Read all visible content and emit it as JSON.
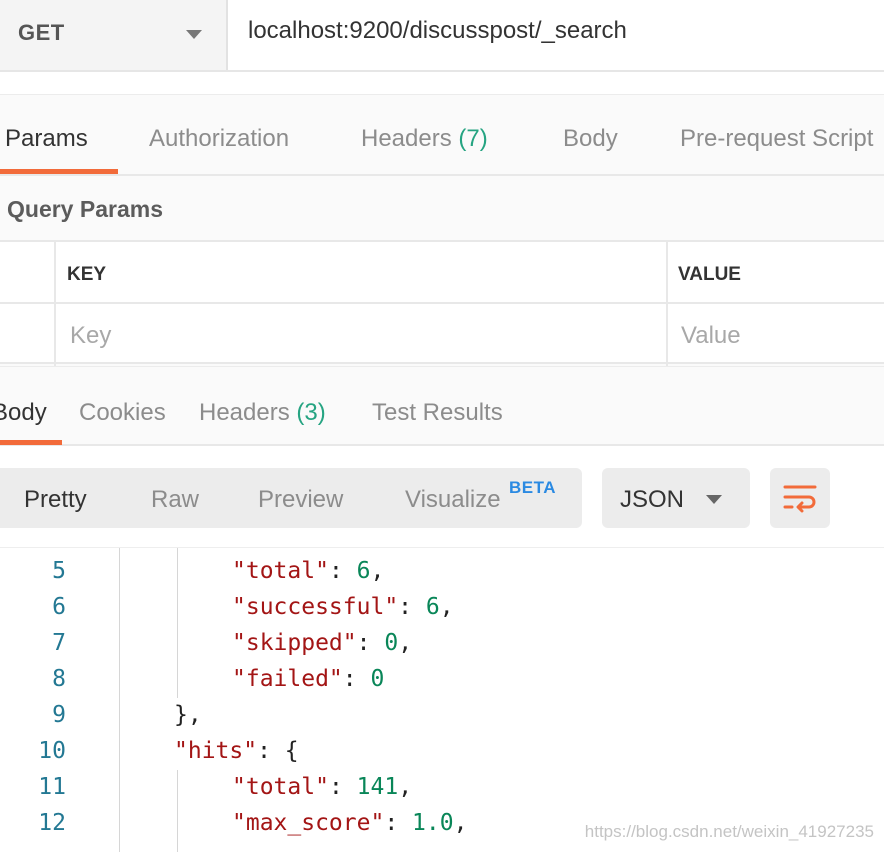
{
  "request": {
    "method": "GET",
    "url": "localhost:9200/discusspost/_search"
  },
  "request_tabs": [
    {
      "label": "Params",
      "active": true
    },
    {
      "label": "Authorization"
    },
    {
      "label": "Headers",
      "count": "(7)"
    },
    {
      "label": "Body"
    },
    {
      "label": "Pre-request Script"
    }
  ],
  "query_params": {
    "title": "Query Params",
    "key_header": "KEY",
    "value_header": "VALUE",
    "key_placeholder": "Key",
    "value_placeholder": "Value"
  },
  "response_tabs": [
    {
      "label": "Body",
      "active": true
    },
    {
      "label": "Cookies"
    },
    {
      "label": "Headers",
      "count": "(3)"
    },
    {
      "label": "Test Results"
    }
  ],
  "viewer": {
    "modes": [
      "Pretty",
      "Raw",
      "Preview",
      "Visualize"
    ],
    "active_mode": "Pretty",
    "beta_badge": "BETA",
    "format": "JSON"
  },
  "code_lines": [
    {
      "num": "5",
      "indent": 2,
      "key": "\"total\"",
      "value": "6",
      "trail": ","
    },
    {
      "num": "6",
      "indent": 2,
      "key": "\"successful\"",
      "value": "6",
      "trail": ","
    },
    {
      "num": "7",
      "indent": 2,
      "key": "\"skipped\"",
      "value": "0",
      "trail": ","
    },
    {
      "num": "8",
      "indent": 2,
      "key": "\"failed\"",
      "value": "0",
      "trail": ""
    },
    {
      "num": "9",
      "indent": 1,
      "text": "},"
    },
    {
      "num": "10",
      "indent": 1,
      "key": "\"hits\"",
      "value": "{",
      "trail": ""
    },
    {
      "num": "11",
      "indent": 2,
      "key": "\"total\"",
      "value": "141",
      "trail": ","
    },
    {
      "num": "12",
      "indent": 2,
      "key": "\"max_score\"",
      "value": "1.0",
      "trail": ","
    }
  ],
  "watermark": "https://blog.csdn.net/weixin_41927235",
  "colors": {
    "accent": "#f26b3a",
    "count": "#26a482",
    "beta": "#2b8ae2",
    "json_key": "#a31515",
    "json_number": "#098658",
    "line_number": "#237893"
  },
  "icons": {
    "method_dropdown": "chevron-down-icon",
    "format_dropdown": "chevron-down-icon",
    "wrap": "wrap-lines-icon"
  }
}
